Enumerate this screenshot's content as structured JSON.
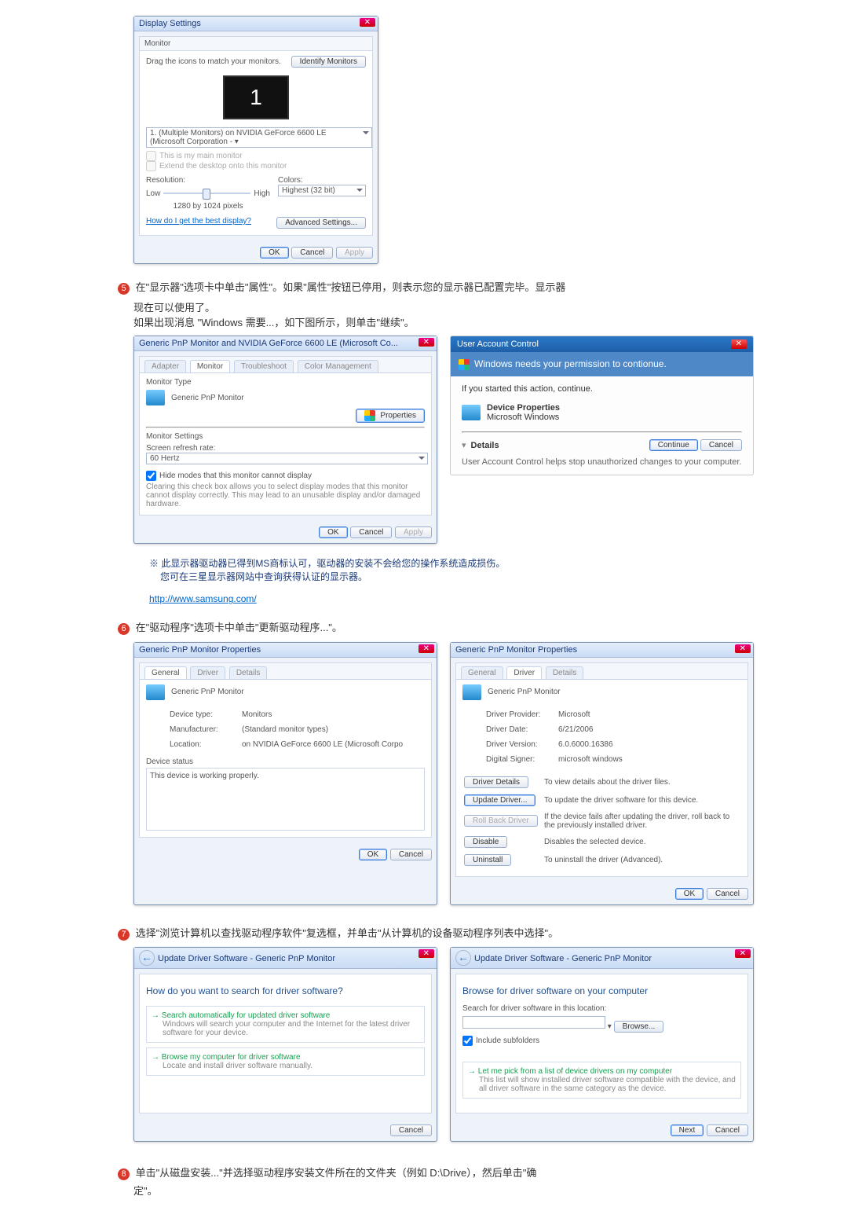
{
  "s1": {
    "title": "Display Settings",
    "tab": "Monitor",
    "drag": "Drag the icons to match your monitors.",
    "identify": "Identify Monitors",
    "monNum": "1",
    "pick": "1. (Multiple Monitors) on NVIDIA GeForce 6600 LE (Microsoft Corporation - ▾",
    "chk1": "This is my main monitor",
    "chk2": "Extend the desktop onto this monitor",
    "resLbl": "Resolution:",
    "low": "Low",
    "high": "High",
    "resVal": "1280 by 1024 pixels",
    "colLbl": "Colors:",
    "colVal": "Highest (32 bit)",
    "howlink": "How do I get the best display?",
    "adv": "Advanced Settings...",
    "ok": "OK",
    "cancel": "Cancel",
    "apply": "Apply"
  },
  "step5": {
    "num": "5",
    "line1": "在\"显示器\"选项卡中单击\"属性\"。如果\"属性\"按钮已停用，则表示您的显示器已配置完毕。显示器",
    "line2": "现在可以使用了。",
    "line3": "如果出现消息 \"Windows 需要...，如下图所示，则单击\"继续\"。"
  },
  "s2": {
    "title": "Generic PnP Monitor and NVIDIA GeForce 6600 LE (Microsoft Co...",
    "t1": "Adapter",
    "t2": "Monitor",
    "t3": "Troubleshoot",
    "t4": "Color Management",
    "mtype": "Monitor Type",
    "mname": "Generic PnP Monitor",
    "prop": "Properties",
    "mset": "Monitor Settings",
    "refresh": "Screen refresh rate:",
    "refreshVal": "60 Hertz",
    "hide": "Hide modes that this monitor cannot display",
    "hideDesc": "Clearing this check box allows you to select display modes that this monitor cannot display correctly. This may lead to an unusable display and/or damaged hardware.",
    "ok": "OK",
    "cancel": "Cancel",
    "apply": "Apply"
  },
  "uac": {
    "title": "User Account Control",
    "needs": "Windows needs your permission to contionue.",
    "started": "If you started this action, continue.",
    "dp": "Device Properties",
    "mw": "Microsoft Windows",
    "details": "Details",
    "cont": "Continue",
    "cancel": "Cancel",
    "help": "User Account Control helps stop unauthorized changes to your computer."
  },
  "note": {
    "mark": "※",
    "l1": "此显示器驱动器已得到MS商标认可，驱动器的安装不会给您的操作系统造成损伤。",
    "l2": "您可在三星显示器网站中查询获得认证的显示器。",
    "url": "http://www.samsung.com/"
  },
  "step6": {
    "num": "6",
    "text": "在\"驱动程序\"选项卡中单击\"更新驱动程序...\"。"
  },
  "s3L": {
    "title": "Generic PnP Monitor Properties",
    "t1": "General",
    "t2": "Driver",
    "t3": "Details",
    "name": "Generic PnP Monitor",
    "dtL": "Device type:",
    "dtV": "Monitors",
    "mfL": "Manufacturer:",
    "mfV": "(Standard monitor types)",
    "locL": "Location:",
    "locV": "on NVIDIA GeForce 6600 LE (Microsoft Corpo",
    "ds": "Device status",
    "dsV": "This device is working properly.",
    "ok": "OK",
    "cancel": "Cancel"
  },
  "s3R": {
    "title": "Generic PnP Monitor Properties",
    "t1": "General",
    "t2": "Driver",
    "t3": "Details",
    "name": "Generic PnP Monitor",
    "dpL": "Driver Provider:",
    "dpV": "Microsoft",
    "ddL": "Driver Date:",
    "ddV": "6/21/2006",
    "dvL": "Driver Version:",
    "dvV": "6.0.6000.16386",
    "dsL": "Digital Signer:",
    "dsV": "microsoft windows",
    "b1": "Driver Details",
    "b1d": "To view details about the driver files.",
    "b2": "Update Driver...",
    "b2d": "To update the driver software for this device.",
    "b3": "Roll Back Driver",
    "b3d": "If the device fails after updating the driver, roll back to the previously installed driver.",
    "b4": "Disable",
    "b4d": "Disables the selected device.",
    "b5": "Uninstall",
    "b5d": "To uninstall the driver (Advanced).",
    "ok": "OK",
    "cancel": "Cancel"
  },
  "step7": {
    "num": "7",
    "text": "选择\"浏览计算机以查找驱动程序软件\"复选框，并单击\"从计算机的设备驱动程序列表中选择\"。"
  },
  "s4L": {
    "title": "Update Driver Software - Generic PnP Monitor",
    "q": "How do you want to search for driver software?",
    "o1": "Search automatically for updated driver software",
    "o1d": "Windows will search your computer and the Internet for the latest driver software for your device.",
    "o2": "Browse my computer for driver software",
    "o2d": "Locate and install driver software manually.",
    "cancel": "Cancel"
  },
  "s4R": {
    "title": "Update Driver Software - Generic PnP Monitor",
    "h": "Browse for driver software on your computer",
    "loc": "Search for driver software in this location:",
    "browse": "Browse...",
    "inc": "Include subfolders",
    "pick": "Let me pick from a list of device drivers on my computer",
    "pickd": "This list will show installed driver software compatible with the device, and all driver software in the same category as the device.",
    "next": "Next",
    "cancel": "Cancel"
  },
  "step8": {
    "num": "8",
    "text": "单击\"从磁盘安装...\"并选择驱动程序安装文件所在的文件夹（例如 D:\\Drive），然后单击\"确",
    "text2": "定\"。"
  }
}
